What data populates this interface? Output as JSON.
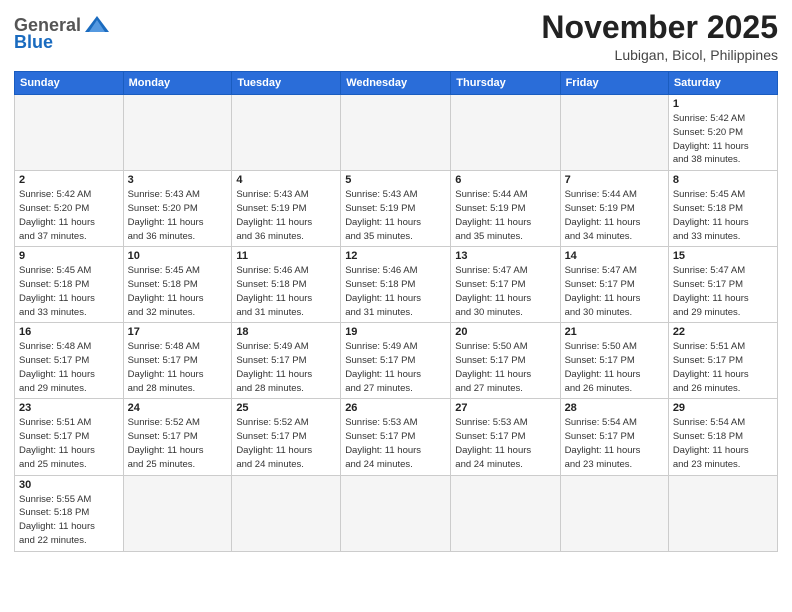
{
  "header": {
    "logo": {
      "general": "General",
      "blue": "Blue"
    },
    "title": "November 2025",
    "location": "Lubigan, Bicol, Philippines"
  },
  "calendar": {
    "days_of_week": [
      "Sunday",
      "Monday",
      "Tuesday",
      "Wednesday",
      "Thursday",
      "Friday",
      "Saturday"
    ],
    "weeks": [
      [
        {
          "day": "",
          "info": ""
        },
        {
          "day": "",
          "info": ""
        },
        {
          "day": "",
          "info": ""
        },
        {
          "day": "",
          "info": ""
        },
        {
          "day": "",
          "info": ""
        },
        {
          "day": "",
          "info": ""
        },
        {
          "day": "1",
          "info": "Sunrise: 5:42 AM\nSunset: 5:20 PM\nDaylight: 11 hours\nand 38 minutes."
        }
      ],
      [
        {
          "day": "2",
          "info": "Sunrise: 5:42 AM\nSunset: 5:20 PM\nDaylight: 11 hours\nand 37 minutes."
        },
        {
          "day": "3",
          "info": "Sunrise: 5:43 AM\nSunset: 5:20 PM\nDaylight: 11 hours\nand 36 minutes."
        },
        {
          "day": "4",
          "info": "Sunrise: 5:43 AM\nSunset: 5:19 PM\nDaylight: 11 hours\nand 36 minutes."
        },
        {
          "day": "5",
          "info": "Sunrise: 5:43 AM\nSunset: 5:19 PM\nDaylight: 11 hours\nand 35 minutes."
        },
        {
          "day": "6",
          "info": "Sunrise: 5:44 AM\nSunset: 5:19 PM\nDaylight: 11 hours\nand 35 minutes."
        },
        {
          "day": "7",
          "info": "Sunrise: 5:44 AM\nSunset: 5:19 PM\nDaylight: 11 hours\nand 34 minutes."
        },
        {
          "day": "8",
          "info": "Sunrise: 5:45 AM\nSunset: 5:18 PM\nDaylight: 11 hours\nand 33 minutes."
        }
      ],
      [
        {
          "day": "9",
          "info": "Sunrise: 5:45 AM\nSunset: 5:18 PM\nDaylight: 11 hours\nand 33 minutes."
        },
        {
          "day": "10",
          "info": "Sunrise: 5:45 AM\nSunset: 5:18 PM\nDaylight: 11 hours\nand 32 minutes."
        },
        {
          "day": "11",
          "info": "Sunrise: 5:46 AM\nSunset: 5:18 PM\nDaylight: 11 hours\nand 31 minutes."
        },
        {
          "day": "12",
          "info": "Sunrise: 5:46 AM\nSunset: 5:18 PM\nDaylight: 11 hours\nand 31 minutes."
        },
        {
          "day": "13",
          "info": "Sunrise: 5:47 AM\nSunset: 5:17 PM\nDaylight: 11 hours\nand 30 minutes."
        },
        {
          "day": "14",
          "info": "Sunrise: 5:47 AM\nSunset: 5:17 PM\nDaylight: 11 hours\nand 30 minutes."
        },
        {
          "day": "15",
          "info": "Sunrise: 5:47 AM\nSunset: 5:17 PM\nDaylight: 11 hours\nand 29 minutes."
        }
      ],
      [
        {
          "day": "16",
          "info": "Sunrise: 5:48 AM\nSunset: 5:17 PM\nDaylight: 11 hours\nand 29 minutes."
        },
        {
          "day": "17",
          "info": "Sunrise: 5:48 AM\nSunset: 5:17 PM\nDaylight: 11 hours\nand 28 minutes."
        },
        {
          "day": "18",
          "info": "Sunrise: 5:49 AM\nSunset: 5:17 PM\nDaylight: 11 hours\nand 28 minutes."
        },
        {
          "day": "19",
          "info": "Sunrise: 5:49 AM\nSunset: 5:17 PM\nDaylight: 11 hours\nand 27 minutes."
        },
        {
          "day": "20",
          "info": "Sunrise: 5:50 AM\nSunset: 5:17 PM\nDaylight: 11 hours\nand 27 minutes."
        },
        {
          "day": "21",
          "info": "Sunrise: 5:50 AM\nSunset: 5:17 PM\nDaylight: 11 hours\nand 26 minutes."
        },
        {
          "day": "22",
          "info": "Sunrise: 5:51 AM\nSunset: 5:17 PM\nDaylight: 11 hours\nand 26 minutes."
        }
      ],
      [
        {
          "day": "23",
          "info": "Sunrise: 5:51 AM\nSunset: 5:17 PM\nDaylight: 11 hours\nand 25 minutes."
        },
        {
          "day": "24",
          "info": "Sunrise: 5:52 AM\nSunset: 5:17 PM\nDaylight: 11 hours\nand 25 minutes."
        },
        {
          "day": "25",
          "info": "Sunrise: 5:52 AM\nSunset: 5:17 PM\nDaylight: 11 hours\nand 24 minutes."
        },
        {
          "day": "26",
          "info": "Sunrise: 5:53 AM\nSunset: 5:17 PM\nDaylight: 11 hours\nand 24 minutes."
        },
        {
          "day": "27",
          "info": "Sunrise: 5:53 AM\nSunset: 5:17 PM\nDaylight: 11 hours\nand 24 minutes."
        },
        {
          "day": "28",
          "info": "Sunrise: 5:54 AM\nSunset: 5:17 PM\nDaylight: 11 hours\nand 23 minutes."
        },
        {
          "day": "29",
          "info": "Sunrise: 5:54 AM\nSunset: 5:18 PM\nDaylight: 11 hours\nand 23 minutes."
        }
      ],
      [
        {
          "day": "30",
          "info": "Sunrise: 5:55 AM\nSunset: 5:18 PM\nDaylight: 11 hours\nand 22 minutes."
        },
        {
          "day": "",
          "info": ""
        },
        {
          "day": "",
          "info": ""
        },
        {
          "day": "",
          "info": ""
        },
        {
          "day": "",
          "info": ""
        },
        {
          "day": "",
          "info": ""
        },
        {
          "day": "",
          "info": ""
        }
      ]
    ]
  }
}
